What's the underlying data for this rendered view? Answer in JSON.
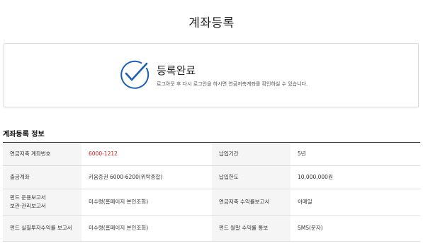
{
  "page": {
    "title": "계좌등록"
  },
  "completion": {
    "title": "등록완료",
    "description": "로그아웃 후 다시 로그인을 하시면 연금저축계좌를 확인하실 수 있습니다.",
    "icon": "check-circle-icon",
    "accent_color": "#1a5fb4"
  },
  "section": {
    "title": "계좌등록 정보"
  },
  "table": {
    "rows": [
      {
        "label1": "연금저축 계좌번호",
        "value1": "6000-1212",
        "label2": "납입기간",
        "value2": "5년"
      },
      {
        "label1": "출금계좌",
        "value1": "키움증권 6000-6200(위탁종합)",
        "label2": "납입한도",
        "value2": "10,000,000원"
      },
      {
        "label1": "펀드 운용보고서\n보관·관리보고서",
        "value1": "미수령(홈페이지 본인조회)",
        "label2": "연금저축 수익률보고서",
        "value2": "이메일"
      },
      {
        "label1": "펀드 실질투자수익률 보고서",
        "value1": "미수령(홈페이지 본인조회)",
        "label2": "펀드 월말 수익률 통보",
        "value2": "SMS(문자)"
      }
    ],
    "highlight_color": "#c81e1e"
  }
}
